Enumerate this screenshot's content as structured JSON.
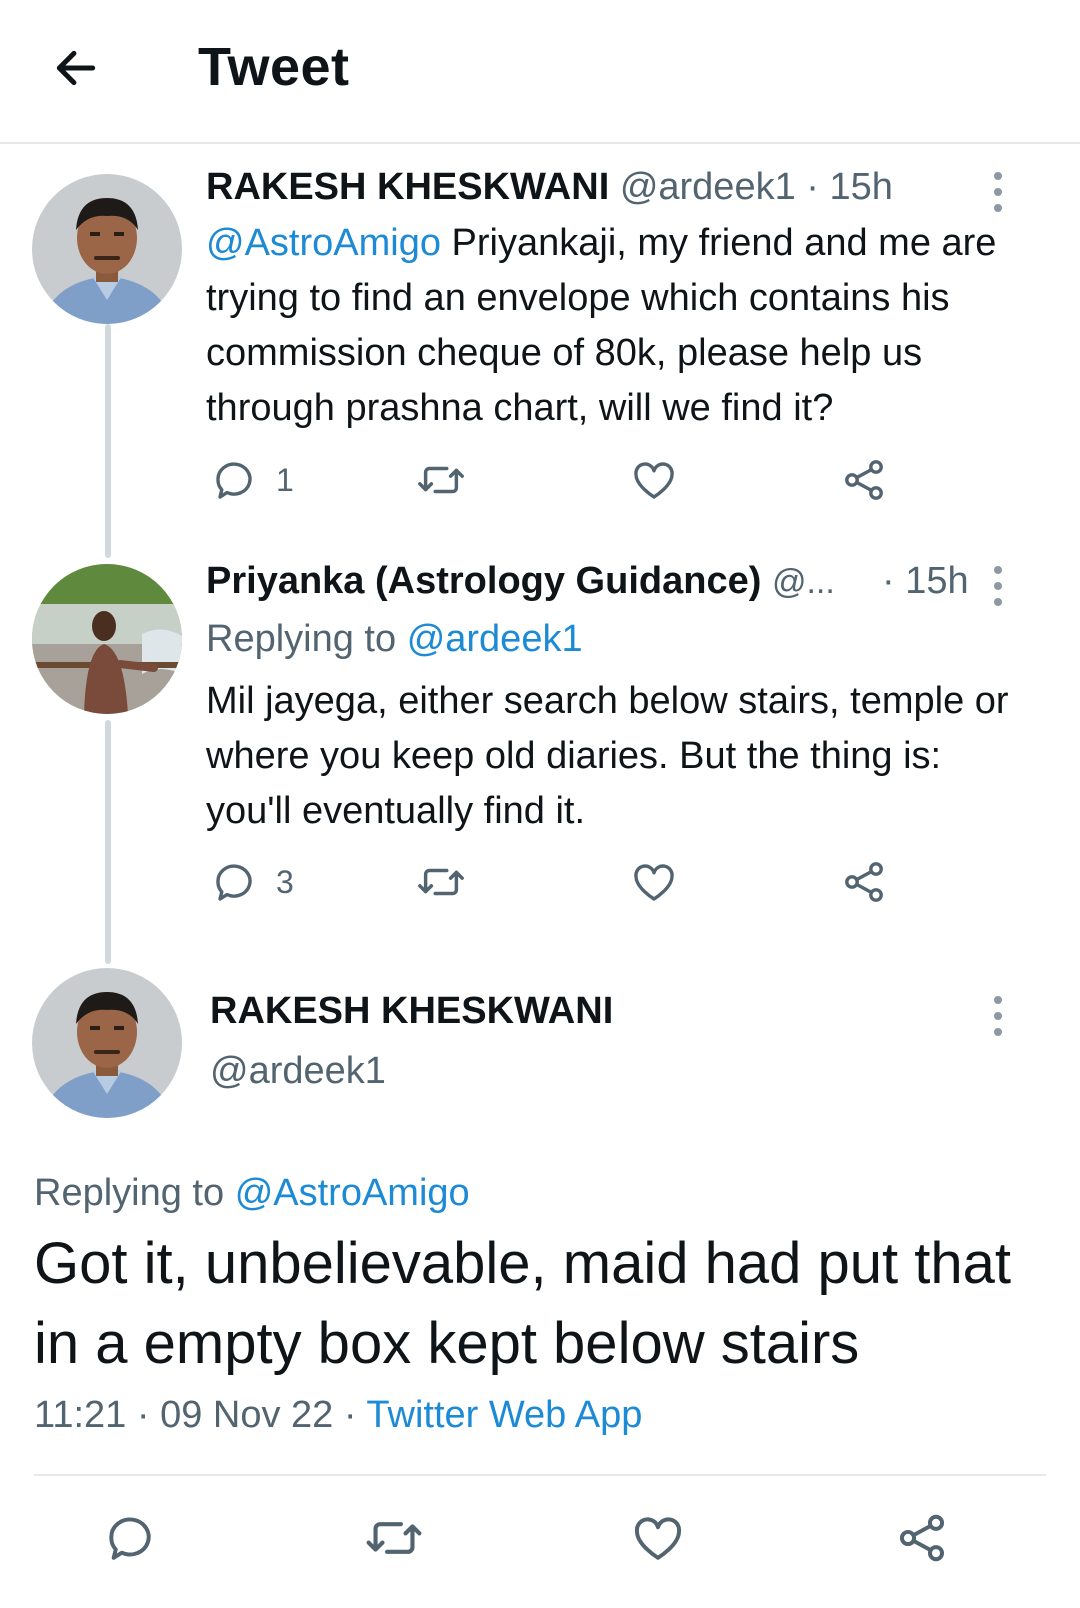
{
  "header": {
    "title": "Tweet"
  },
  "tweets": [
    {
      "display_name": "RAKESH KHESKWANI",
      "handle": "@ardeek1",
      "time": "· 15h",
      "mention": "@AstroAmigo",
      "text": " Priyankaji, my friend and me are trying to find an envelope which contains his commission cheque of 80k, please help us through prashna chart, will we find it?",
      "reply_count": "1"
    },
    {
      "display_name": "Priyanka (Astrology Guidance)",
      "handle": "@...",
      "time": "· 15h",
      "replying_label": "Replying to",
      "replying_to": "@ardeek1",
      "text": "Mil jayega, either search below stairs, temple or where you keep old diaries. But the thing is: you'll eventually find it.",
      "reply_count": "3"
    }
  ],
  "main_tweet": {
    "display_name": "RAKESH KHESKWANI",
    "handle": "@ardeek1",
    "replying_label": "Replying to",
    "replying_to": "@AstroAmigo",
    "text": "Got it, unbelievable, maid had put that in a empty box kept below stairs",
    "time": "11:21",
    "date": "09 Nov 22",
    "source": "Twitter Web App"
  },
  "icons": {
    "back": "arrow-left-icon",
    "reply": "speech-bubble-icon",
    "retweet": "retweet-icon",
    "like": "heart-icon",
    "share": "share-icon",
    "more": "vertical-dots-icon"
  },
  "colors": {
    "link": "#1d8ad6",
    "muted": "#536471",
    "text": "#0f1419",
    "thread_line": "#cfd9de"
  }
}
